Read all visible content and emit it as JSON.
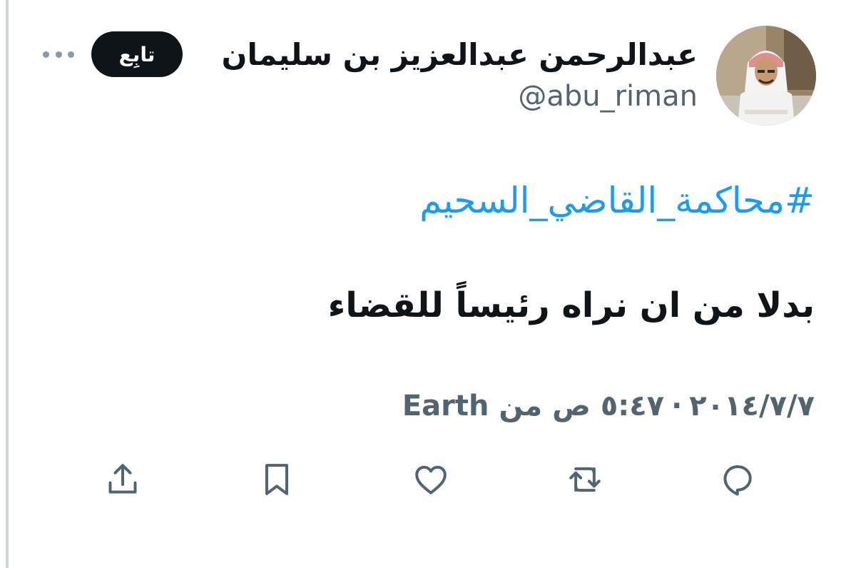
{
  "tweet": {
    "display_name": "عبدالرحمن عبدالعزيز بن سليمان",
    "handle": "@abu_riman",
    "follow_label": "تابِع",
    "hashtag": "#محاكمة_القاضي_السحيم",
    "text": "بدلا من ان نراه رئيساً للقضاء",
    "date": "٢٠١٤/٧/٧",
    "time": "٥:٤٧ ص",
    "source": "من Earth",
    "separator": "·"
  },
  "icons": {
    "reply": "reply-icon",
    "retweet": "retweet-icon",
    "like": "heart-icon",
    "bookmark": "bookmark-icon",
    "share": "share-icon",
    "more": "more-icon"
  },
  "colors": {
    "link": "#1d9bf0",
    "secondary_text": "#536471",
    "primary_text": "#0f1419",
    "follow_bg": "#0f1419"
  }
}
